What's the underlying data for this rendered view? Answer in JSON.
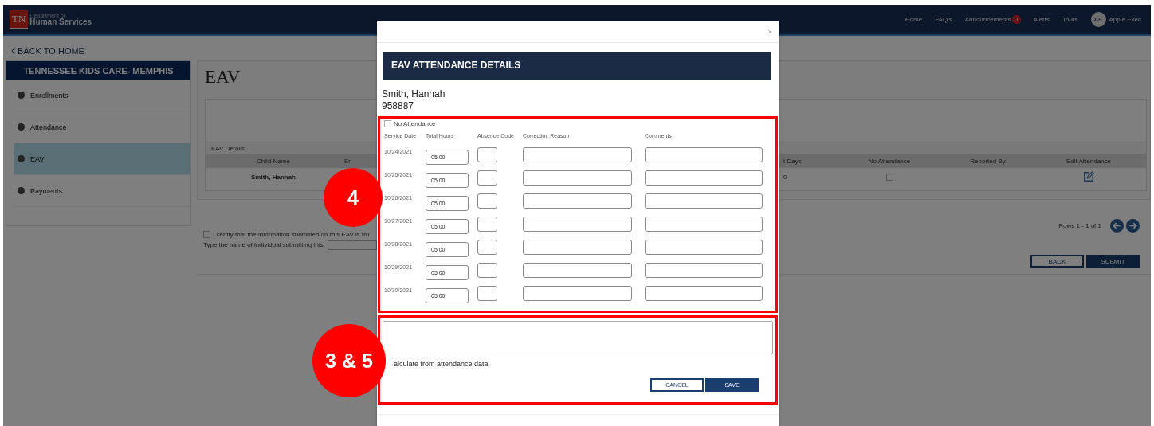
{
  "header": {
    "logo": {
      "mark": "TN",
      "small": "Department of",
      "name": "Human Services"
    },
    "nav": [
      {
        "label": "Home"
      },
      {
        "label": "FAQ's"
      },
      {
        "label": "Announcements",
        "badge": "0"
      },
      {
        "label": "Alerts"
      },
      {
        "label": "Tours"
      }
    ],
    "user": {
      "initials": "AE",
      "name": "Apple Exec"
    }
  },
  "back_link": "BACK TO HOME",
  "sidebar": {
    "title": "TENNESSEE KIDS CARE- MEMPHIS",
    "items": [
      {
        "label": "Enrollments",
        "selected": false
      },
      {
        "label": "Attendance",
        "selected": false
      },
      {
        "label": "EAV",
        "selected": true
      },
      {
        "label": "Payments",
        "selected": false
      }
    ]
  },
  "page_title": "EAV",
  "table": {
    "caption": "EAV Details",
    "columns_left": [
      "Child Name",
      "Er"
    ],
    "columns_right": [
      "t Days",
      "No Attendance",
      "Reported By",
      "Edit Attendance"
    ],
    "rows": [
      {
        "child_name": "Smith, Hannah",
        "days": "0",
        "no_attendance": false
      }
    ]
  },
  "certify": {
    "checked": false,
    "text": "I certify that the information submitted on this EAV is tru",
    "name_label": "Type the name of individual submitting this:"
  },
  "pager": {
    "text": "Rows 1 - 1 of 1"
  },
  "buttons": [
    {
      "label": "BACK",
      "kind": "secondary"
    },
    {
      "label": "SUBMIT",
      "kind": "primary"
    }
  ],
  "modal": {
    "close": "×",
    "title": "EAV ATTENDANCE DETAILS",
    "child_name": "Smith, Hannah",
    "child_id": "958887",
    "no_attendance": {
      "label": "No Attendance",
      "checked": false
    },
    "columns": [
      "Service Date",
      "Total Hours",
      "Absence Code",
      "Correction Reason",
      "Comments"
    ],
    "rows": [
      {
        "date": "10/24/2021",
        "hours": "05:00"
      },
      {
        "date": "10/25/2021",
        "hours": "05:00"
      },
      {
        "date": "10/26/2021",
        "hours": "05:00"
      },
      {
        "date": "10/27/2021",
        "hours": "05:00"
      },
      {
        "date": "10/28/2021",
        "hours": "05:00"
      },
      {
        "date": "10/29/2021",
        "hours": "05:00"
      },
      {
        "date": "10/30/2021",
        "hours": "05:00"
      }
    ],
    "recalculate": "alculate from attendance data",
    "buttons": [
      {
        "label": "CANCEL",
        "kind": "secondary"
      },
      {
        "label": "SAVE",
        "kind": "primary"
      }
    ]
  },
  "callouts": [
    {
      "label": "4"
    },
    {
      "label": "3 & 5"
    }
  ]
}
